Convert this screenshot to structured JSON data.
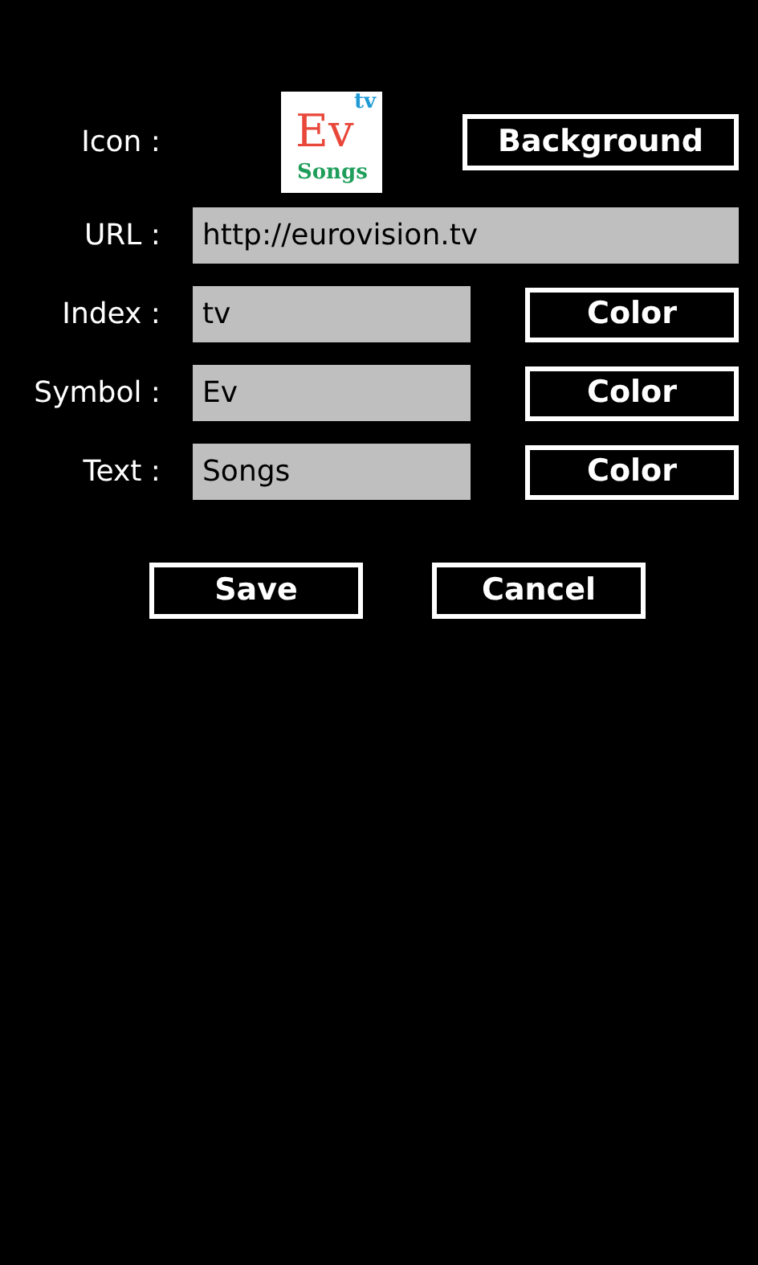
{
  "icon_row": {
    "label": "Icon :",
    "preview": {
      "index": {
        "text": "tv",
        "color": "#1e9bd7"
      },
      "symbol": {
        "text": "Ev",
        "color": "#e8473a"
      },
      "text": {
        "text": "Songs",
        "color": "#1e9e5a"
      }
    },
    "button": "Background"
  },
  "url_row": {
    "label": "URL :",
    "value": "http://eurovision.tv"
  },
  "fields": [
    {
      "label": "Index :",
      "value": "tv",
      "button": "Color"
    },
    {
      "label": "Symbol :",
      "value": "Ev",
      "button": "Color"
    },
    {
      "label": "Text :",
      "value": "Songs",
      "button": "Color"
    }
  ],
  "actions": [
    "Save",
    "Cancel"
  ]
}
